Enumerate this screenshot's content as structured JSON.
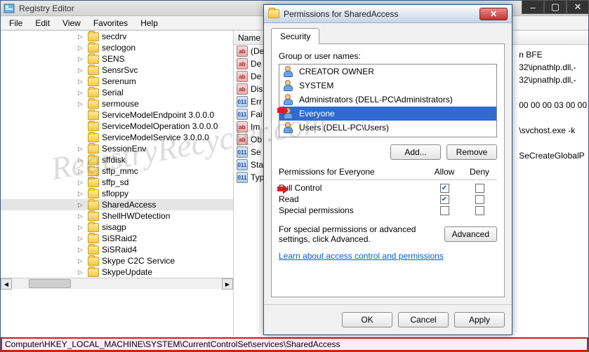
{
  "window": {
    "title": "Registry Editor",
    "menus": [
      "File",
      "Edit",
      "View",
      "Favorites",
      "Help"
    ]
  },
  "tree": {
    "items": [
      {
        "label": "secdrv",
        "exp": "▷"
      },
      {
        "label": "seclogon",
        "exp": "▷"
      },
      {
        "label": "SENS",
        "exp": "▷"
      },
      {
        "label": "SensrSvc",
        "exp": "▷"
      },
      {
        "label": "Serenum",
        "exp": "▷"
      },
      {
        "label": "Serial",
        "exp": "▷"
      },
      {
        "label": "sermouse",
        "exp": "▷"
      },
      {
        "label": "ServiceModelEndpoint 3.0.0.0",
        "exp": ""
      },
      {
        "label": "ServiceModelOperation 3.0.0.0",
        "exp": ""
      },
      {
        "label": "ServiceModelService 3.0.0.0",
        "exp": ""
      },
      {
        "label": "SessionEnv",
        "exp": "▷"
      },
      {
        "label": "sffdisk",
        "exp": "▷"
      },
      {
        "label": "sffp_mmc",
        "exp": "▷"
      },
      {
        "label": "sffp_sd",
        "exp": "▷"
      },
      {
        "label": "sfloppy",
        "exp": "▷"
      },
      {
        "label": "SharedAccess",
        "exp": "▷",
        "selected": true
      },
      {
        "label": "ShellHWDetection",
        "exp": "▷"
      },
      {
        "label": "sisagp",
        "exp": "▷"
      },
      {
        "label": "SiSRaid2",
        "exp": "▷"
      },
      {
        "label": "SiSRaid4",
        "exp": "▷"
      },
      {
        "label": "Skype C2C Service",
        "exp": "▷"
      },
      {
        "label": "SkypeUpdate",
        "exp": "▷"
      }
    ]
  },
  "values": {
    "header": "Name",
    "rows": [
      {
        "k": "ab",
        "name": "(De"
      },
      {
        "k": "ab",
        "name": "De"
      },
      {
        "k": "ab",
        "name": "De"
      },
      {
        "k": "ab",
        "name": "Dis"
      },
      {
        "k": "bin",
        "name": "Err"
      },
      {
        "k": "bin",
        "name": "Fai"
      },
      {
        "k": "ab",
        "name": "Im"
      },
      {
        "k": "ab",
        "name": "Ob"
      },
      {
        "k": "bin",
        "name": "Se"
      },
      {
        "k": "bin",
        "name": "Sta"
      },
      {
        "k": "bin",
        "name": "Typ"
      }
    ],
    "right_snippets": [
      "n BFE",
      "32\\ipnathlp.dll,-",
      "32\\ipnathlp.dll,-",
      "",
      "00 00 00 03 00 00",
      "",
      "\\svchost.exe -k",
      "",
      "SeCreateGlobalP"
    ]
  },
  "statusbar": {
    "path": "Computer\\HKEY_LOCAL_MACHINE\\SYSTEM\\CurrentControlSet\\services\\SharedAccess"
  },
  "dialog": {
    "title": "Permissions for SharedAccess",
    "tab": "Security",
    "group_label": "Group or user names:",
    "groups": [
      {
        "name": "CREATOR OWNER"
      },
      {
        "name": "SYSTEM"
      },
      {
        "name": "Administrators (DELL-PC\\Administrators)"
      },
      {
        "name": "Everyone",
        "selected": true
      },
      {
        "name": "Users (DELL-PC\\Users)"
      }
    ],
    "add_btn": "Add...",
    "remove_btn": "Remove",
    "perm_for": "Permissions for Everyone",
    "col_allow": "Allow",
    "col_deny": "Deny",
    "perms": [
      {
        "label": "Full Control",
        "allow": true,
        "deny": false
      },
      {
        "label": "Read",
        "allow": true,
        "deny": false
      },
      {
        "label": "Special permissions",
        "allow": false,
        "deny": false
      }
    ],
    "adv_text": "For special permissions or advanced settings, click Advanced.",
    "adv_btn": "Advanced",
    "link": "Learn about access control and permissions",
    "ok": "OK",
    "cancel": "Cancel",
    "apply": "Apply"
  },
  "watermark": "RegistryRecycler.com"
}
